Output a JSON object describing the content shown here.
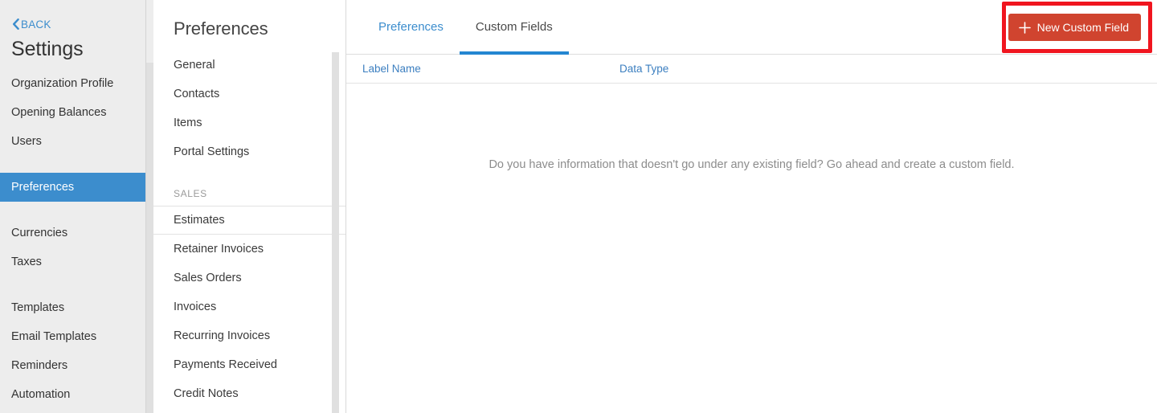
{
  "sidebar": {
    "back": {
      "label": "BACK",
      "icon": "chevron-left-icon"
    },
    "title": "Settings",
    "groups": [
      {
        "items": [
          {
            "label": "Organization Profile",
            "active": false
          },
          {
            "label": "Opening Balances",
            "active": false
          },
          {
            "label": "Users",
            "active": false
          }
        ]
      },
      {
        "items": [
          {
            "label": "Preferences",
            "active": true
          }
        ]
      },
      {
        "items": [
          {
            "label": "Currencies",
            "active": false
          },
          {
            "label": "Taxes",
            "active": false
          }
        ]
      },
      {
        "items": [
          {
            "label": "Templates",
            "active": false
          },
          {
            "label": "Email Templates",
            "active": false
          },
          {
            "label": "Reminders",
            "active": false
          },
          {
            "label": "Automation",
            "active": false
          }
        ]
      }
    ]
  },
  "preferences_panel": {
    "title": "Preferences",
    "items": [
      {
        "label": "General",
        "selected": false
      },
      {
        "label": "Contacts",
        "selected": false
      },
      {
        "label": "Items",
        "selected": false
      },
      {
        "label": "Portal Settings",
        "selected": false
      }
    ],
    "section_label": "SALES",
    "sales_items": [
      {
        "label": "Estimates",
        "selected": true
      },
      {
        "label": "Retainer Invoices",
        "selected": false
      },
      {
        "label": "Sales Orders",
        "selected": false
      },
      {
        "label": "Invoices",
        "selected": false
      },
      {
        "label": "Recurring Invoices",
        "selected": false
      },
      {
        "label": "Payments Received",
        "selected": false
      },
      {
        "label": "Credit Notes",
        "selected": false
      }
    ]
  },
  "main": {
    "tabs": [
      {
        "label": "Preferences",
        "active": false
      },
      {
        "label": "Custom Fields",
        "active": true
      }
    ],
    "new_field_button": {
      "label": "New Custom Field",
      "icon": "plus-icon"
    },
    "table": {
      "columns": [
        "Label Name",
        "Data Type"
      ],
      "rows": [],
      "empty_message": "Do you have information that doesn't go under any existing field? Go ahead and create a custom field."
    }
  },
  "colors": {
    "sidebar_bg": "#ededed",
    "sidebar_active": "#3c8dcd",
    "link_blue": "#3c8dcd",
    "tab_underline": "#2486d1",
    "button_red": "#d0442f",
    "highlight_red": "#f0151f",
    "table_header_text": "#3c7fc0",
    "empty_text": "#8c8c8c"
  }
}
